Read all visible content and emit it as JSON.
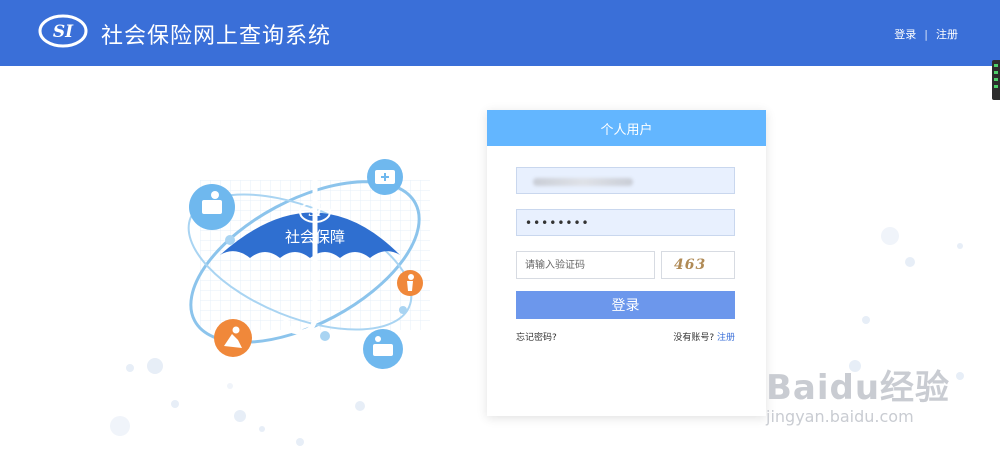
{
  "header": {
    "title": "社会保险网上查询系统",
    "logo_text": "SI",
    "login": "登录",
    "separator": "|",
    "register": "注册"
  },
  "illustration": {
    "umbrella_logo": "SI",
    "umbrella_text": "社会保障"
  },
  "login_card": {
    "heading": "个人用户",
    "username_value": "",
    "password_value": "••••••••",
    "captcha_placeholder": "请输入验证码",
    "captcha_code": "463",
    "login_button": "登录",
    "forgot_password": "忘记密码?",
    "no_account": "没有账号?",
    "register_link": "注册"
  },
  "watermark": {
    "main": "Baidu经验",
    "sub": "jingyan.baidu.com"
  },
  "colors": {
    "header_bg": "#3a6fd8",
    "card_head_bg": "#63b6ff",
    "button_bg": "#6c97ec",
    "accent_orange": "#f0883a"
  },
  "icons": [
    "si-logo-icon",
    "umbrella-icon",
    "worker-icon",
    "medical-kit-icon",
    "elderly-icon",
    "injury-icon",
    "maternity-icon"
  ]
}
